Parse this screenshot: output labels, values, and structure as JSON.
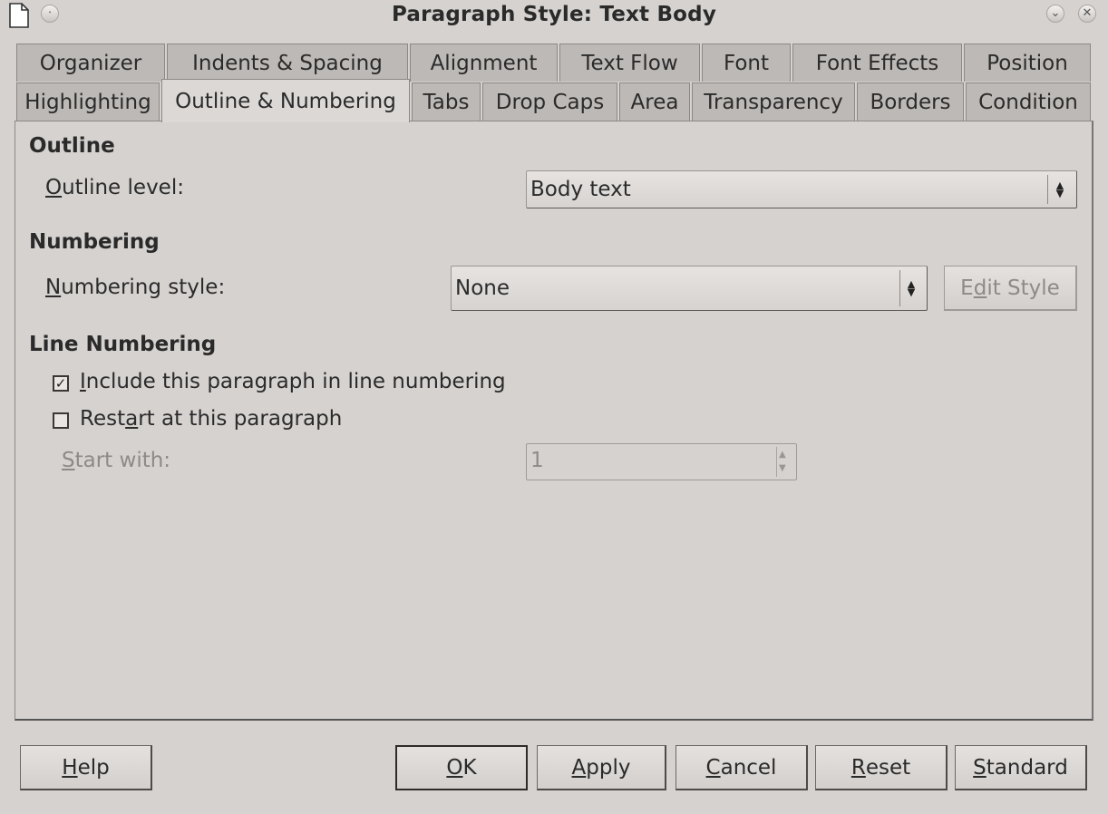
{
  "window": {
    "title": "Paragraph Style: Text Body",
    "doc_icon": "document-icon",
    "menu_icon": "window-menu-icon",
    "minimize_icon": "chevron-down-icon",
    "close_icon": "close-icon"
  },
  "tabs_row1": [
    {
      "label": "Organizer"
    },
    {
      "label": "Indents & Spacing"
    },
    {
      "label": "Alignment"
    },
    {
      "label": "Text Flow"
    },
    {
      "label": "Font"
    },
    {
      "label": "Font Effects"
    },
    {
      "label": "Position"
    }
  ],
  "tabs_row2": [
    {
      "label": "Highlighting"
    },
    {
      "label": "Outline & Numbering",
      "active": true
    },
    {
      "label": "Tabs"
    },
    {
      "label": "Drop Caps"
    },
    {
      "label": "Area"
    },
    {
      "label": "Transparency"
    },
    {
      "label": "Borders"
    },
    {
      "label": "Condition"
    }
  ],
  "outline": {
    "heading": "Outline",
    "level_label_mn": "O",
    "level_label_rest": "utline level:",
    "level_value": "Body text"
  },
  "numbering": {
    "heading": "Numbering",
    "style_label_mn": "N",
    "style_label_rest": "umbering style:",
    "style_value": "None",
    "edit_pre": "E",
    "edit_mn": "d",
    "edit_post": "it Style"
  },
  "line_numbering": {
    "heading": "Line Numbering",
    "include_mn": "I",
    "include_rest": "nclude this paragraph in line numbering",
    "include_checked": true,
    "restart_pre": "Rest",
    "restart_mn": "a",
    "restart_post": "rt at this paragraph",
    "restart_checked": false,
    "start_mn": "S",
    "start_rest": "tart with:",
    "start_value": "1"
  },
  "buttons": {
    "help_mn": "H",
    "help_rest": "elp",
    "ok_mn": "O",
    "ok_rest": "K",
    "apply_mn": "A",
    "apply_rest": "pply",
    "cancel_mn": "C",
    "cancel_rest": "ancel",
    "reset_mn": "R",
    "reset_rest": "eset",
    "standard_mn": "S",
    "standard_rest": "tandard"
  }
}
